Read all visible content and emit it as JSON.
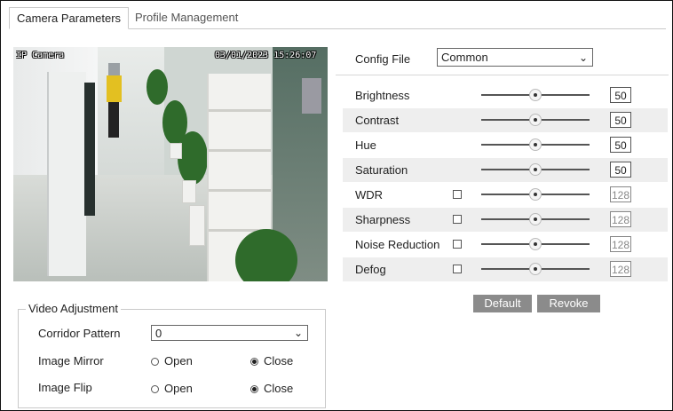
{
  "tabs": [
    {
      "label": "Camera Parameters",
      "active": true
    },
    {
      "label": "Profile Management",
      "active": false
    }
  ],
  "video": {
    "osd_name": "IP Camera",
    "osd_datetime": "03/01/2023 15:26:07"
  },
  "config": {
    "label": "Config File",
    "selected": "Common"
  },
  "params": [
    {
      "label": "Brightness",
      "value": "50",
      "has_checkbox": false,
      "checked": false,
      "level": 0.5
    },
    {
      "label": "Contrast",
      "value": "50",
      "has_checkbox": false,
      "checked": false,
      "level": 0.5
    },
    {
      "label": "Hue",
      "value": "50",
      "has_checkbox": false,
      "checked": false,
      "level": 0.5
    },
    {
      "label": "Saturation",
      "value": "50",
      "has_checkbox": false,
      "checked": false,
      "level": 0.5
    },
    {
      "label": "WDR",
      "value": "128",
      "has_checkbox": true,
      "checked": false,
      "level": 0.5
    },
    {
      "label": "Sharpness",
      "value": "128",
      "has_checkbox": true,
      "checked": false,
      "level": 0.5
    },
    {
      "label": "Noise Reduction",
      "value": "128",
      "has_checkbox": true,
      "checked": false,
      "level": 0.5
    },
    {
      "label": "Defog",
      "value": "128",
      "has_checkbox": true,
      "checked": false,
      "level": 0.5
    }
  ],
  "buttons": {
    "default_label": "Default",
    "revoke_label": "Revoke"
  },
  "video_adjustment": {
    "legend": "Video Adjustment",
    "corridor_label": "Corridor Pattern",
    "corridor_value": "0",
    "mirror_label": "Image Mirror",
    "flip_label": "Image Flip",
    "open_label": "Open",
    "close_label": "Close",
    "mirror_selected": "Close",
    "flip_selected": "Close"
  },
  "colors": {
    "button_bg": "#8b8b8b",
    "row_alt": "#eeeeee"
  }
}
